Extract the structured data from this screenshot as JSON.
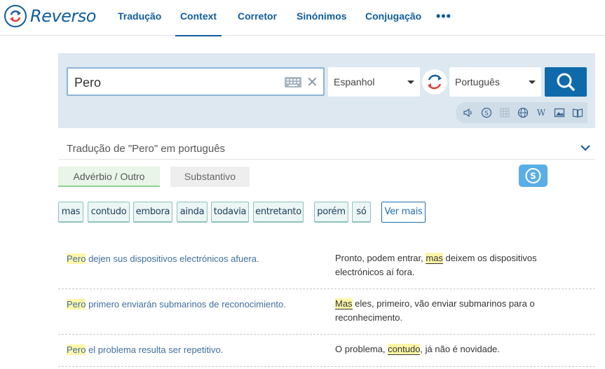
{
  "nav": {
    "logo_text": "Reverso",
    "items": [
      "Tradução",
      "Context",
      "Corretor",
      "Sinónimos",
      "Conjugação"
    ],
    "more": "•••"
  },
  "search": {
    "query": "Pero",
    "source_lang": "Espanhol",
    "target_lang": "Português"
  },
  "translation": {
    "title": "Tradução de \"Pero\" em português",
    "pos_tabs": [
      "Advérbio / Outro",
      "Substantivo"
    ],
    "chips": [
      "mas",
      "contudo",
      "embora",
      "ainda",
      "todavia",
      "entretanto",
      "porém",
      "só"
    ],
    "more_label": "Ver mais"
  },
  "examples": [
    {
      "src_hl": "Pero",
      "src_rest": " dejen sus dispositivos electrónicos afuera.",
      "trg_pre": "Pronto, podem entrar, ",
      "trg_hl": "mas",
      "trg_post": " deixem os dispositivos electrónicos aí fora."
    },
    {
      "src_hl": "Pero",
      "src_rest": " primero enviarán submarinos de reconocimiento.",
      "trg_pre": "",
      "trg_hl": "Mas",
      "trg_post": " eles, primeiro, vão enviar submarinos para o reconhecimento."
    },
    {
      "src_hl": "Pero",
      "src_rest": " el problema resulta ser repetitivo.",
      "trg_pre": "O problema, ",
      "trg_hl": "contudo",
      "trg_post": ", já não é novidade."
    }
  ],
  "colors": {
    "brand": "#0f5d9e",
    "search_panel": "#dde8f1",
    "highlight": "#fff6a8"
  }
}
